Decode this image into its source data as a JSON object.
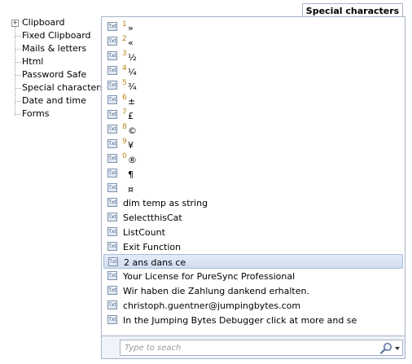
{
  "tab": {
    "label": "Special characters"
  },
  "tree": {
    "items": [
      {
        "label": "Clipboard",
        "expandable": true
      },
      {
        "label": "Fixed Clipboard"
      },
      {
        "label": "Mails & letters"
      },
      {
        "label": "Html"
      },
      {
        "label": "Password Safe"
      },
      {
        "label": "Special characters"
      },
      {
        "label": "Date and time"
      },
      {
        "label": "Forms"
      }
    ],
    "expander_glyph": "+"
  },
  "list": {
    "icon_label": "Txt",
    "items": [
      {
        "num": "1",
        "text": "»",
        "kind": "symbol"
      },
      {
        "num": "2",
        "text": "«",
        "kind": "symbol"
      },
      {
        "num": "3",
        "text": "½",
        "kind": "symbol"
      },
      {
        "num": "4",
        "text": "¼",
        "kind": "symbol"
      },
      {
        "num": "5",
        "text": "¾",
        "kind": "symbol"
      },
      {
        "num": "6",
        "text": "±",
        "kind": "symbol"
      },
      {
        "num": "7",
        "text": "£",
        "kind": "symbol"
      },
      {
        "num": "8",
        "text": "©",
        "kind": "symbol"
      },
      {
        "num": "9",
        "text": "¥",
        "kind": "symbol"
      },
      {
        "num": "0",
        "text": "®",
        "kind": "symbol"
      },
      {
        "num": "",
        "text": "¶",
        "kind": "symbol"
      },
      {
        "num": "",
        "text": "¤",
        "kind": "symbol"
      },
      {
        "num": "",
        "text": "dim temp as string",
        "kind": "text"
      },
      {
        "num": "",
        "text": "SelectthisCat",
        "kind": "text"
      },
      {
        "num": "",
        "text": "ListCount",
        "kind": "text"
      },
      {
        "num": "",
        "text": "Exit Function",
        "kind": "text"
      },
      {
        "num": "",
        "text": "2 ans dans ce",
        "kind": "text",
        "selected": true
      },
      {
        "num": "",
        "text": "Your License for PureSync Professional",
        "kind": "text"
      },
      {
        "num": "",
        "text": "Wir haben die Zahlung dankend erhalten.",
        "kind": "text"
      },
      {
        "num": "",
        "text": "christoph.guentner@jumpingbytes.com",
        "kind": "text"
      },
      {
        "num": "",
        "text": "In the Jumping Bytes Debugger click at more and se",
        "kind": "text"
      }
    ]
  },
  "search": {
    "placeholder": "Type to seach",
    "icon": "search-icon"
  },
  "colors": {
    "accent": "#a6b3c6",
    "selection": "#d1ddf0",
    "number": "#b8861f"
  }
}
